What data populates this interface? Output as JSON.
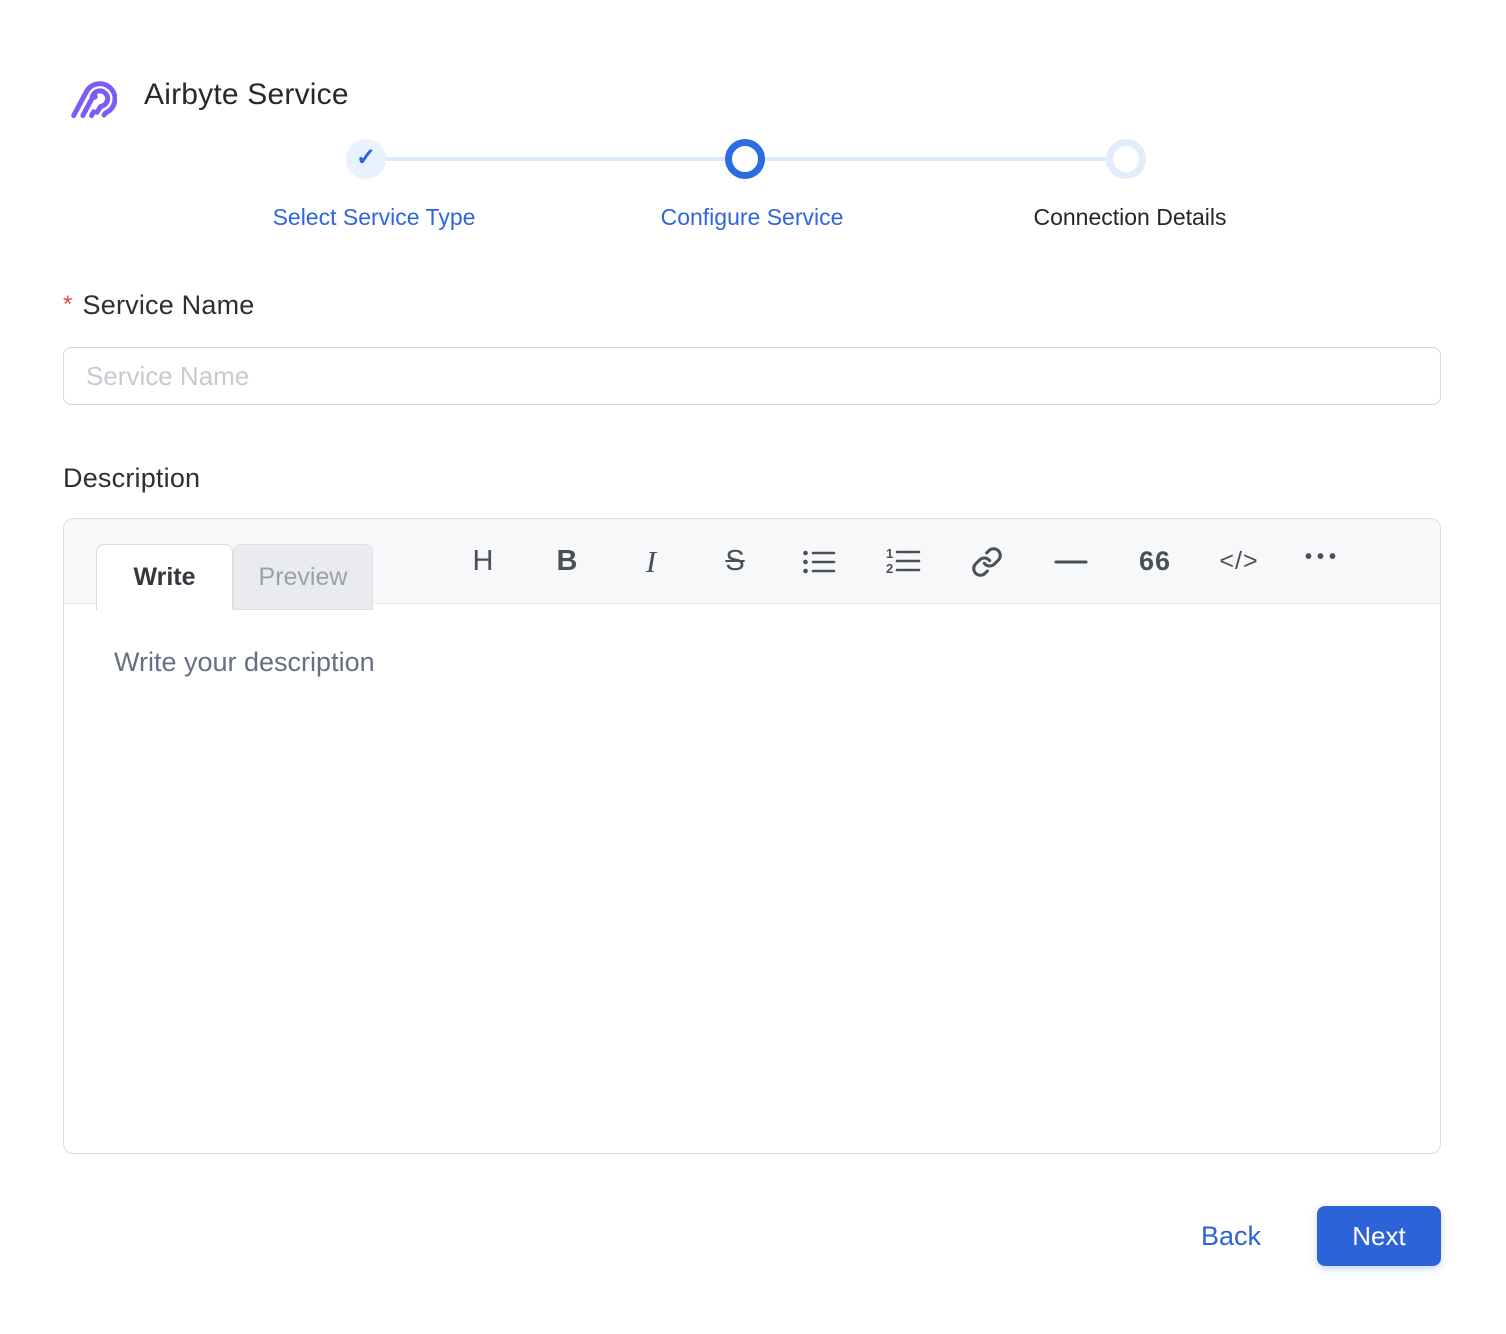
{
  "header": {
    "title": "Airbyte Service"
  },
  "stepper": {
    "check_glyph": "✓",
    "steps": [
      {
        "label": "Select Service Type",
        "state": "completed"
      },
      {
        "label": "Configure Service",
        "state": "current"
      },
      {
        "label": "Connection Details",
        "state": "upcoming"
      }
    ]
  },
  "form": {
    "service_name": {
      "required_marker": "*",
      "label": "Service Name",
      "placeholder": "Service Name",
      "value": ""
    },
    "description": {
      "label": "Description",
      "tabs": {
        "write": "Write",
        "preview": "Preview"
      },
      "toolbar_glyphs": {
        "heading": "H",
        "bold": "B",
        "italic": "I",
        "strikethrough": "S",
        "quote": "66",
        "code": "</>",
        "more": "•••"
      },
      "placeholder": "Write your description",
      "value": ""
    }
  },
  "footer": {
    "back": "Back",
    "next": "Next"
  },
  "colors": {
    "primary_blue": "#2d63d8",
    "step_active_blue": "#2b6ce0",
    "step_track_blue": "#dbe9fb",
    "step_done_bg": "#e8f1fd",
    "label_blue": "#3066db",
    "required_red": "#e5484d",
    "logo_purple": "#7b5cf7"
  }
}
